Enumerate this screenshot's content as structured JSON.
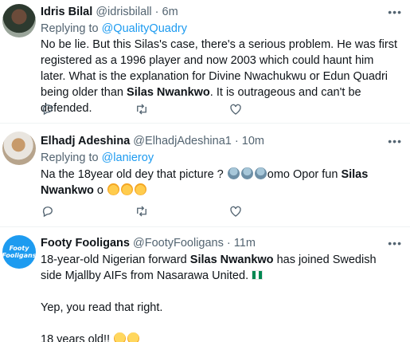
{
  "tweets": [
    {
      "name": "Idris Bilal",
      "handle": "@idrisbilall",
      "sep": "·",
      "time": "6m",
      "reply_prefix": "Replying to ",
      "reply_to": "@QualityQuadry",
      "body_1": "No be lie. But this Silas's case, there's a serious problem. He was first registered as a 1996 player and now 2003 which could haunt him later. What is the explanation for Divine Nwachukwu or Edun Quadri being older than ",
      "body_bold": "Silas Nwankwo",
      "body_2": ". It is outrageous and can't be defended."
    },
    {
      "name": "Elhadj Adeshina",
      "handle": "@ElhadjAdeshina1",
      "sep": "·",
      "time": "10m",
      "reply_prefix": "Replying to ",
      "reply_to": "@lanieroy",
      "body_1": "Na the 18year old dey that picture ? ",
      "body_mid": "omo Opor fun ",
      "body_bold": "Silas Nwankwo",
      "body_2": " o "
    },
    {
      "name": "Footy Fooligans",
      "handle": "@FootyFooligans",
      "sep": "·",
      "time": "11m",
      "avatar_text_1": "Footy",
      "avatar_text_2": "Fooligans",
      "body_1": "18-year-old Nigerian forward ",
      "body_bold": "Silas Nwankwo",
      "body_2": " has joined Swedish side Mjallby AIFs from Nasarawa United. ",
      "line_2": "Yep, you read that right.",
      "line_3": "18 years old!! "
    }
  ],
  "icons": {
    "more": "more-dots-icon",
    "reply": "reply-icon",
    "retweet": "retweet-icon",
    "like": "like-icon",
    "share": "share-icon"
  },
  "colors": {
    "accent": "#1d9bf0",
    "secondary": "#536471",
    "text": "#0f1419"
  }
}
